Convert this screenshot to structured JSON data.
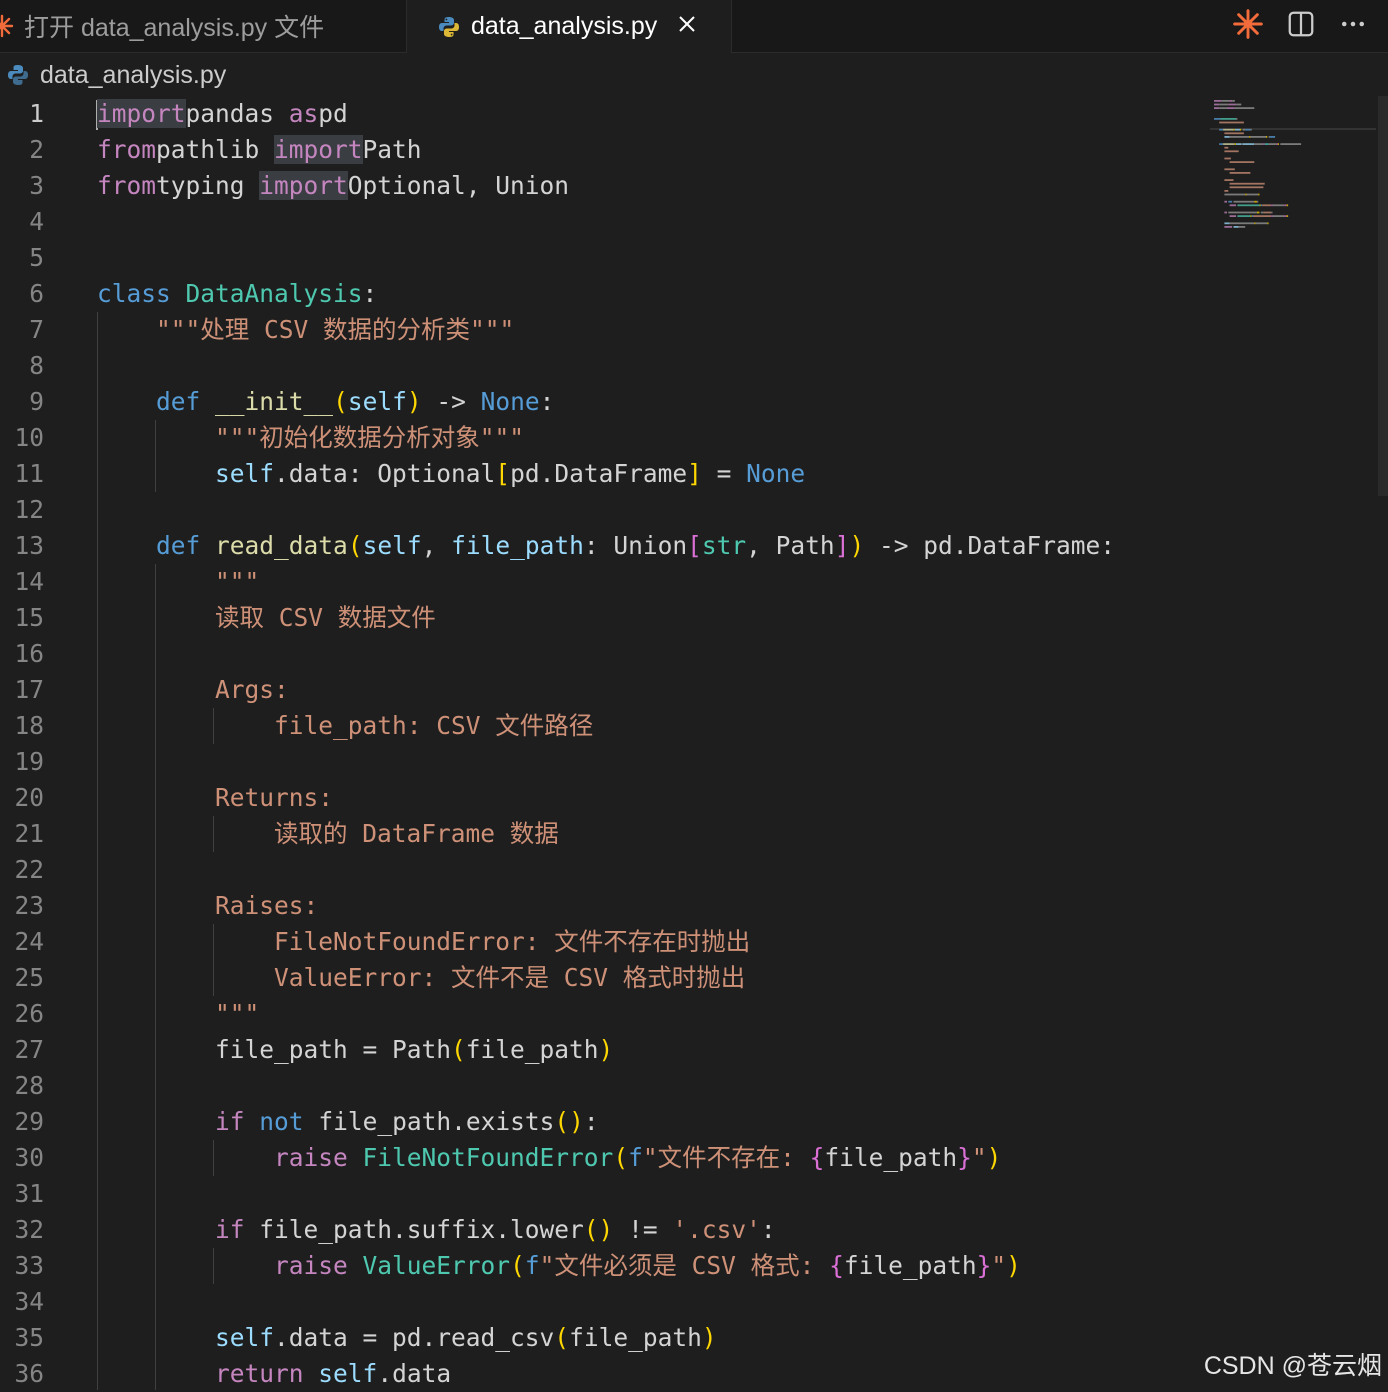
{
  "tabs": [
    {
      "label": "打开 data_analysis.py 文件",
      "active": false
    },
    {
      "label": "data_analysis.py",
      "active": true
    }
  ],
  "tab_actions": [
    "spark-icon",
    "split-editor-icon",
    "more-actions-icon"
  ],
  "breadcrumb": "data_analysis.py",
  "watermark": "CSDN @苍云烟",
  "colors": {
    "keyword_control": "#c586c0",
    "keyword": "#569cd6",
    "class": "#4ec9b0",
    "function": "#dcdcaa",
    "string": "#ce9178",
    "variable": "#9cdcfe",
    "bracket1": "#ffd700",
    "bracket2": "#da70d6",
    "bracket3": "#179fff",
    "accent_spark": "#f26b3a"
  },
  "active_line": 1,
  "lines": [
    [
      [
        "kw hl",
        "import"
      ],
      [
        "",
        "pandas "
      ],
      [
        "kw",
        "as"
      ],
      [
        "",
        "pd"
      ]
    ],
    [
      [
        "kw",
        "from"
      ],
      [
        "",
        "pathlib "
      ],
      [
        "kw hl",
        "import"
      ],
      [
        "",
        "Path"
      ]
    ],
    [
      [
        "kw",
        "from"
      ],
      [
        "",
        "typing "
      ],
      [
        "kw hl",
        "import"
      ],
      [
        "",
        "Optional, Union"
      ]
    ],
    [],
    [],
    [
      [
        "kwb",
        "class"
      ],
      [
        "cls",
        "DataAnalysis"
      ],
      [
        "",
        ":"
      ]
    ],
    [
      [
        "",
        "    "
      ],
      [
        "str",
        "\"\"\"处理 CSV 数据的分析类\"\"\""
      ]
    ],
    [],
    [
      [
        "",
        "    "
      ],
      [
        "kwb",
        "def"
      ],
      [
        "fn",
        "__init__"
      ],
      [
        "p1",
        "("
      ],
      [
        "var",
        "self"
      ],
      [
        "p1",
        ")"
      ],
      [
        "",
        " -> "
      ],
      [
        "kwb",
        "None"
      ],
      [
        "",
        ":"
      ]
    ],
    [
      [
        "",
        "        "
      ],
      [
        "str",
        "\"\"\"初始化数据分析对象\"\"\""
      ]
    ],
    [
      [
        "",
        "        "
      ],
      [
        "var",
        "self"
      ],
      [
        "",
        ".data: Optional"
      ],
      [
        "p1",
        "["
      ],
      [
        "",
        "pd.DataFrame"
      ],
      [
        "p1",
        "]"
      ],
      [
        "",
        " = "
      ],
      [
        "kwb",
        "None"
      ]
    ],
    [],
    [
      [
        "",
        "    "
      ],
      [
        "kwb",
        "def"
      ],
      [
        "fn",
        "read_data"
      ],
      [
        "p1",
        "("
      ],
      [
        "var",
        "self"
      ],
      [
        "",
        ", "
      ],
      [
        "var",
        "file_path"
      ],
      [
        "",
        ": Union"
      ],
      [
        "p2",
        "["
      ],
      [
        "cls",
        "str"
      ],
      [
        "",
        ", Path"
      ],
      [
        "p2",
        "]"
      ],
      [
        "p1",
        ")"
      ],
      [
        "",
        " -> pd.DataFrame:"
      ]
    ],
    [
      [
        "",
        "        "
      ],
      [
        "str",
        "\"\"\""
      ]
    ],
    [
      [
        "",
        "        "
      ],
      [
        "str",
        "读取 CSV 数据文件"
      ]
    ],
    [],
    [
      [
        "",
        "        "
      ],
      [
        "str",
        "Args:"
      ]
    ],
    [
      [
        "",
        "            "
      ],
      [
        "str",
        "file_path: CSV 文件路径"
      ]
    ],
    [],
    [
      [
        "",
        "        "
      ],
      [
        "str",
        "Returns:"
      ]
    ],
    [
      [
        "",
        "            "
      ],
      [
        "str",
        "读取的 DataFrame 数据"
      ]
    ],
    [],
    [
      [
        "",
        "        "
      ],
      [
        "str",
        "Raises:"
      ]
    ],
    [
      [
        "",
        "            "
      ],
      [
        "str",
        "FileNotFoundError: 文件不存在时抛出"
      ]
    ],
    [
      [
        "",
        "            "
      ],
      [
        "str",
        "ValueError: 文件不是 CSV 格式时抛出"
      ]
    ],
    [
      [
        "",
        "        "
      ],
      [
        "str",
        "\"\"\""
      ]
    ],
    [
      [
        "",
        "        file_path = Path"
      ],
      [
        "p1",
        "("
      ],
      [
        "",
        "file_path"
      ],
      [
        "p1",
        ")"
      ]
    ],
    [],
    [
      [
        "",
        "        "
      ],
      [
        "kw",
        "if"
      ],
      [
        "",
        " "
      ],
      [
        "kwb",
        "not"
      ],
      [
        "",
        " file_path.exists"
      ],
      [
        "p1",
        "()"
      ],
      [
        "",
        ":"
      ]
    ],
    [
      [
        "",
        "            "
      ],
      [
        "kw",
        "raise"
      ],
      [
        "",
        " "
      ],
      [
        "cls",
        "FileNotFoundError"
      ],
      [
        "p1",
        "("
      ],
      [
        "kwb",
        "f"
      ],
      [
        "str",
        "\"文件不存在: "
      ],
      [
        "p2",
        "{"
      ],
      [
        "",
        "file_path"
      ],
      [
        "p2",
        "}"
      ],
      [
        "str",
        "\""
      ],
      [
        "p1",
        ")"
      ]
    ],
    [],
    [
      [
        "",
        "        "
      ],
      [
        "kw",
        "if"
      ],
      [
        "",
        " file_path.suffix.lower"
      ],
      [
        "p1",
        "()"
      ],
      [
        "",
        " != "
      ],
      [
        "str",
        "'.csv'"
      ],
      [
        "",
        ":"
      ]
    ],
    [
      [
        "",
        "            "
      ],
      [
        "kw",
        "raise"
      ],
      [
        "",
        " "
      ],
      [
        "cls",
        "ValueError"
      ],
      [
        "p1",
        "("
      ],
      [
        "kwb",
        "f"
      ],
      [
        "str",
        "\"文件必须是 CSV 格式: "
      ],
      [
        "p2",
        "{"
      ],
      [
        "",
        "file_path"
      ],
      [
        "p2",
        "}"
      ],
      [
        "str",
        "\""
      ],
      [
        "p1",
        ")"
      ]
    ],
    [],
    [
      [
        "",
        "        "
      ],
      [
        "var",
        "self"
      ],
      [
        "",
        ".data = pd.read_csv"
      ],
      [
        "p1",
        "("
      ],
      [
        "",
        "file_path"
      ],
      [
        "p1",
        ")"
      ]
    ],
    [
      [
        "",
        "        "
      ],
      [
        "kw",
        "return"
      ],
      [
        "",
        " "
      ],
      [
        "var",
        "self"
      ],
      [
        "",
        ".data"
      ]
    ]
  ]
}
